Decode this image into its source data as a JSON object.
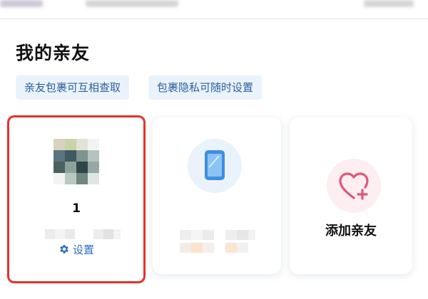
{
  "page": {
    "title": "我的亲友"
  },
  "chips": [
    {
      "label": "亲友包裹可互相查取"
    },
    {
      "label": "包裹隐私可随时设置"
    }
  ],
  "cards": {
    "friend": {
      "name": "1",
      "settings_label": "设置",
      "selected": true
    },
    "device": {},
    "add": {
      "label": "添加亲友"
    }
  },
  "colors": {
    "accent_blue": "#2b6cc4",
    "chip_bg": "#eaf3fc",
    "highlight_red": "#e3322c",
    "heart_pink": "#e0557a"
  }
}
